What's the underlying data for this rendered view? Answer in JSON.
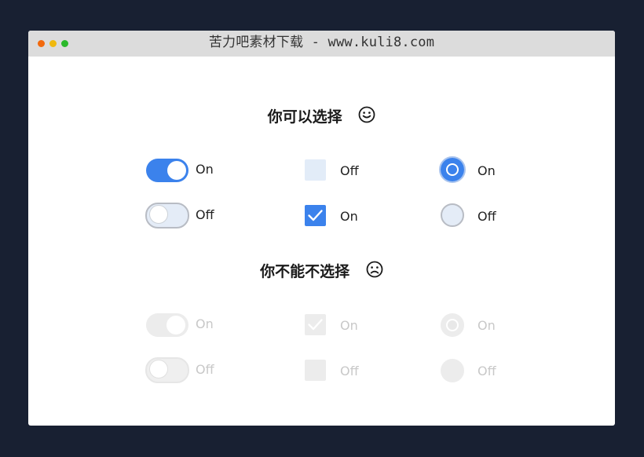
{
  "window": {
    "title": "苦力吧素材下载 - www.kuli8.com"
  },
  "sections": {
    "enabled": {
      "heading": "你可以选择",
      "face_icon": "smile-icon",
      "toggle_on_label": "On",
      "toggle_off_label": "Off",
      "checkbox_off_label": "Off",
      "checkbox_on_label": "On",
      "radio_on_label": "On",
      "radio_off_label": "Off"
    },
    "disabled": {
      "heading": "你不能不选择",
      "face_icon": "frown-icon",
      "toggle_on_label": "On",
      "toggle_off_label": "Off",
      "checkbox_on_label": "On",
      "checkbox_off_label": "Off",
      "radio_on_label": "On",
      "radio_off_label": "Off"
    }
  },
  "colors": {
    "background": "#182032",
    "accent": "#3b82ec",
    "inactive_fill": "#e4ecf7",
    "disabled_fill": "#ececec",
    "disabled_text": "#c8c8c8"
  }
}
